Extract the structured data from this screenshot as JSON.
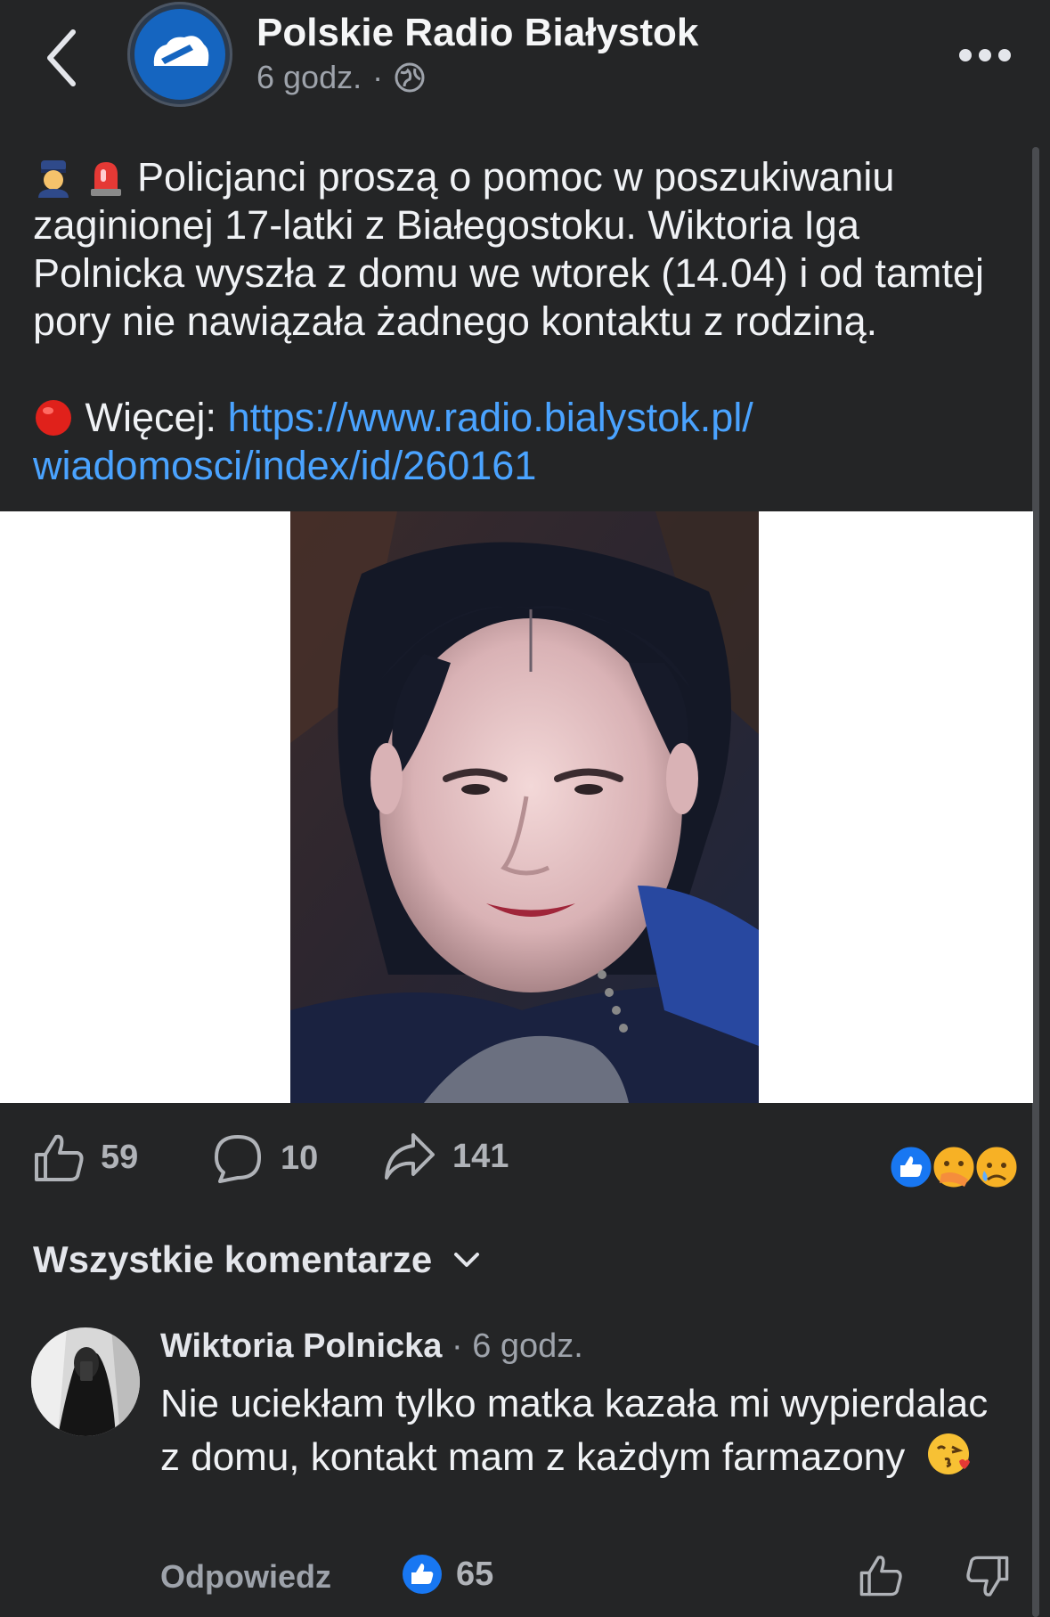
{
  "header": {
    "page_name": "Polskie Radio Białystok",
    "time": "6 godz.",
    "separator": "·",
    "audience_icon": "globe-icon",
    "back_icon": "chevron-left-icon",
    "more_icon": "more-dots-icon"
  },
  "post": {
    "paragraph1": "Policjanci proszą o pomoc w poszukiwaniu zaginionej 17-latki z Białegostoku. Wiktoria Iga Polnicka wyszła z domu we wtorek (14.04) i od tamtej pory nie nawiązała żadnego kontaktu z rodziną.",
    "more_label": "Więcej:",
    "link_line1": "https://www.radio.bialystok.pl/",
    "link_line2": "wiadomosci/index/id/260161",
    "emojis": [
      "police-officer-emoji",
      "siren-emoji",
      "red-circle-emoji"
    ]
  },
  "stats": {
    "likes": "59",
    "comments": "10",
    "shares": "141",
    "reaction_icons": [
      "like-reaction",
      "care-reaction",
      "sad-reaction"
    ]
  },
  "comments_section": {
    "title": "Wszystkie komentarze"
  },
  "comment": {
    "author": "Wiktoria Polnicka",
    "time": "· 6 godz.",
    "text": "Nie uciekłam tylko matka kazała mi wypierdalac z domu, kontakt mam z każdym farmazony",
    "reply_label": "Odpowiedz",
    "likes": "65"
  },
  "colors": {
    "background": "#242526",
    "link": "#4aa3ff",
    "like_blue": "#1877f2",
    "muted": "#9ea3ab"
  }
}
